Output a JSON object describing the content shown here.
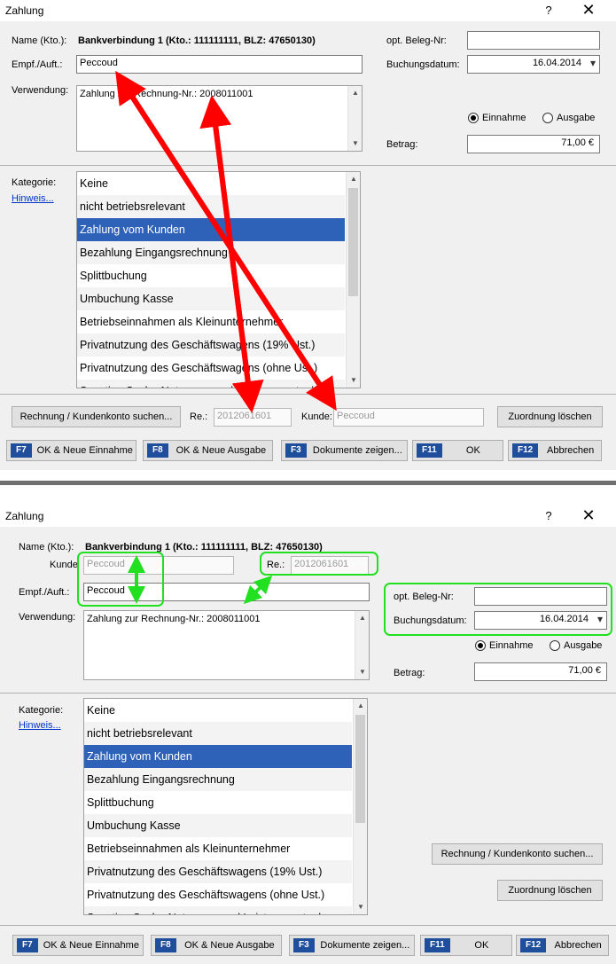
{
  "dialog": {
    "title": "Zahlung",
    "help_glyph": "?",
    "close_glyph": "✕"
  },
  "labels": {
    "name": "Name (Kto.):",
    "account": "Bankverbindung 1 (Kto.: 111111111, BLZ: 47650130)",
    "empf": "Empf./Auft.:",
    "verwendung": "Verwendung:",
    "beleg": "opt. Beleg-Nr:",
    "buchungsdatum": "Buchungsdatum:",
    "betrag": "Betrag:",
    "kategorie": "Kategorie:",
    "hinweis": "Hinweis...",
    "re": "Re.:",
    "kunde": "Kunde:",
    "kunde_bottom": "Kunde"
  },
  "values": {
    "empf": "Peccoud",
    "verwendung": "Zahlung zur Rechnung-Nr.: 2008011001",
    "beleg": "",
    "buchungsdatum": "16.04.2014",
    "betrag": "71,00 €",
    "re": "2012061601",
    "kunde": "Peccoud"
  },
  "radios": {
    "einnahme": "Einnahme",
    "ausgabe": "Ausgabe",
    "selected": "einnahme"
  },
  "categories": [
    "Keine",
    "nicht betriebsrelevant",
    "Zahlung vom Kunden",
    "Bezahlung Eingangsrechnung",
    "Splittbuchung",
    "Umbuchung Kasse",
    "Betriebseinnahmen als Kleinunternehmer",
    "Privatnutzung des Geschäftswagens (19% Ust.)",
    "Privatnutzung des Geschäftswagens (ohne Ust.)",
    "Sonstige Sach-, Nutzungs- und Leistungsentnahmen"
  ],
  "selected_category": 2,
  "buttons": {
    "rechnung_suchen": "Rechnung / Kundenkonto suchen...",
    "zuordnung_loeschen": "Zuordnung löschen"
  },
  "fkeys": [
    {
      "key": "F7",
      "label": "OK & Neue Einnahme"
    },
    {
      "key": "F8",
      "label": "OK & Neue Ausgabe"
    },
    {
      "key": "F3",
      "label": "Dokumente zeigen..."
    },
    {
      "key": "F11",
      "label": "OK"
    },
    {
      "key": "F12",
      "label": "Abbrechen"
    }
  ],
  "icons": {
    "dropdown": "▾",
    "scroll_up": "▲",
    "scroll_down": "▼"
  },
  "colors": {
    "selection": "#2e62b8",
    "fkey_badge": "#1f4e9c",
    "annotation_arrow": "#ff0000",
    "annotation_highlight": "#20e020"
  }
}
